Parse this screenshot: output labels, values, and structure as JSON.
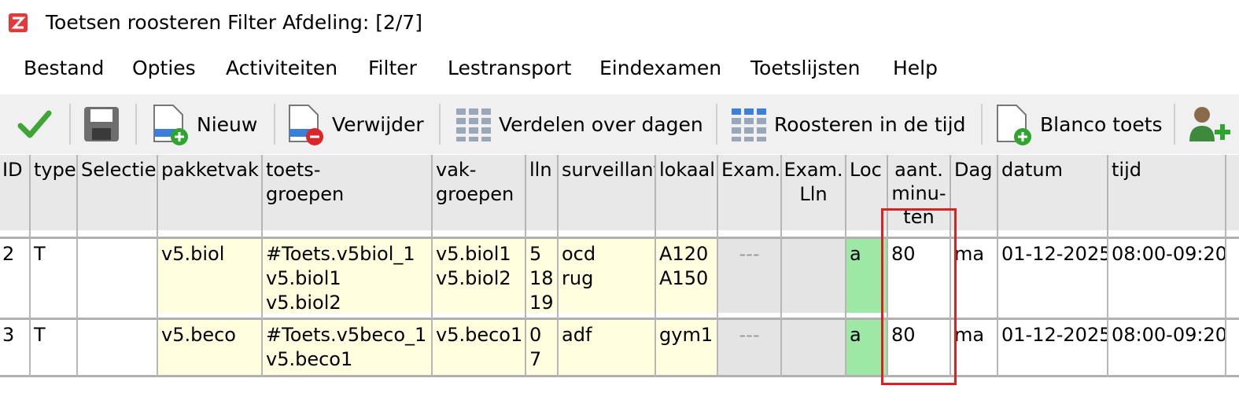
{
  "window": {
    "title": "Toetsen roosteren  Filter Afdeling: [2/7]"
  },
  "menu": [
    "Bestand",
    "Opties",
    "Activiteiten",
    "Filter",
    "Lestransport",
    "Eindexamen",
    "Toetslijsten",
    "Help"
  ],
  "toolbar": {
    "new_label": "Nieuw",
    "delete_label": "Verwijder",
    "distribute_label": "Verdelen over dagen",
    "schedule_label": "Roosteren in de tijd",
    "blank_label": "Blanco toets"
  },
  "table": {
    "headers": {
      "id": "ID",
      "type": "type",
      "selectie": "Selectie",
      "pakketvak": "pakketvak",
      "toetsgroepen": "toets-\ngroepen",
      "vakgroepen": "vak-\ngroepen",
      "lln": "lln",
      "surveillant": "surveillant",
      "lokaal": "lokaal",
      "exam": "Exam.",
      "exam_lln": "Exam.\nLln",
      "loc": "Loc",
      "aant_minuten": "aant.\nminu-\nten",
      "dag": "Dag",
      "datum": "datum",
      "tijd": "tijd"
    },
    "rows": [
      {
        "id": "2",
        "type": "T",
        "selectie": "",
        "pakketvak": "v5.biol",
        "toetsgroepen": "#Toets.v5biol_1\nv5.biol1\nv5.biol2",
        "vakgroepen": "v5.biol1\nv5.biol2",
        "lln": "5\n18\n19",
        "surveillant": "ocd\nrug",
        "lokaal": "A120\nA150",
        "exam": "---",
        "exam_lln": "",
        "loc": "a",
        "aant_minuten": "80",
        "dag": "ma",
        "datum": "01-12-2025",
        "tijd": "08:00-09:20"
      },
      {
        "id": "3",
        "type": "T",
        "selectie": "",
        "pakketvak": "v5.beco",
        "toetsgroepen": "#Toets.v5beco_1\nv5.beco1",
        "vakgroepen": "v5.beco1",
        "lln": "0\n7",
        "surveillant": "adf",
        "lokaal": "gym1",
        "exam": "---",
        "exam_lln": "",
        "loc": "a",
        "aant_minuten": "80",
        "dag": "ma",
        "datum": "01-12-2025",
        "tijd": "08:00-09:20"
      }
    ]
  },
  "colors": {
    "highlight": "#e02020",
    "yellow_cell": "#ffffe0",
    "loc_green": "#9ee8a6"
  },
  "icons": [
    "app-icon",
    "check-icon",
    "save-icon",
    "new-icon",
    "delete-icon",
    "grid-icon",
    "grid-icon",
    "blank-test-icon",
    "user-add-icon"
  ]
}
